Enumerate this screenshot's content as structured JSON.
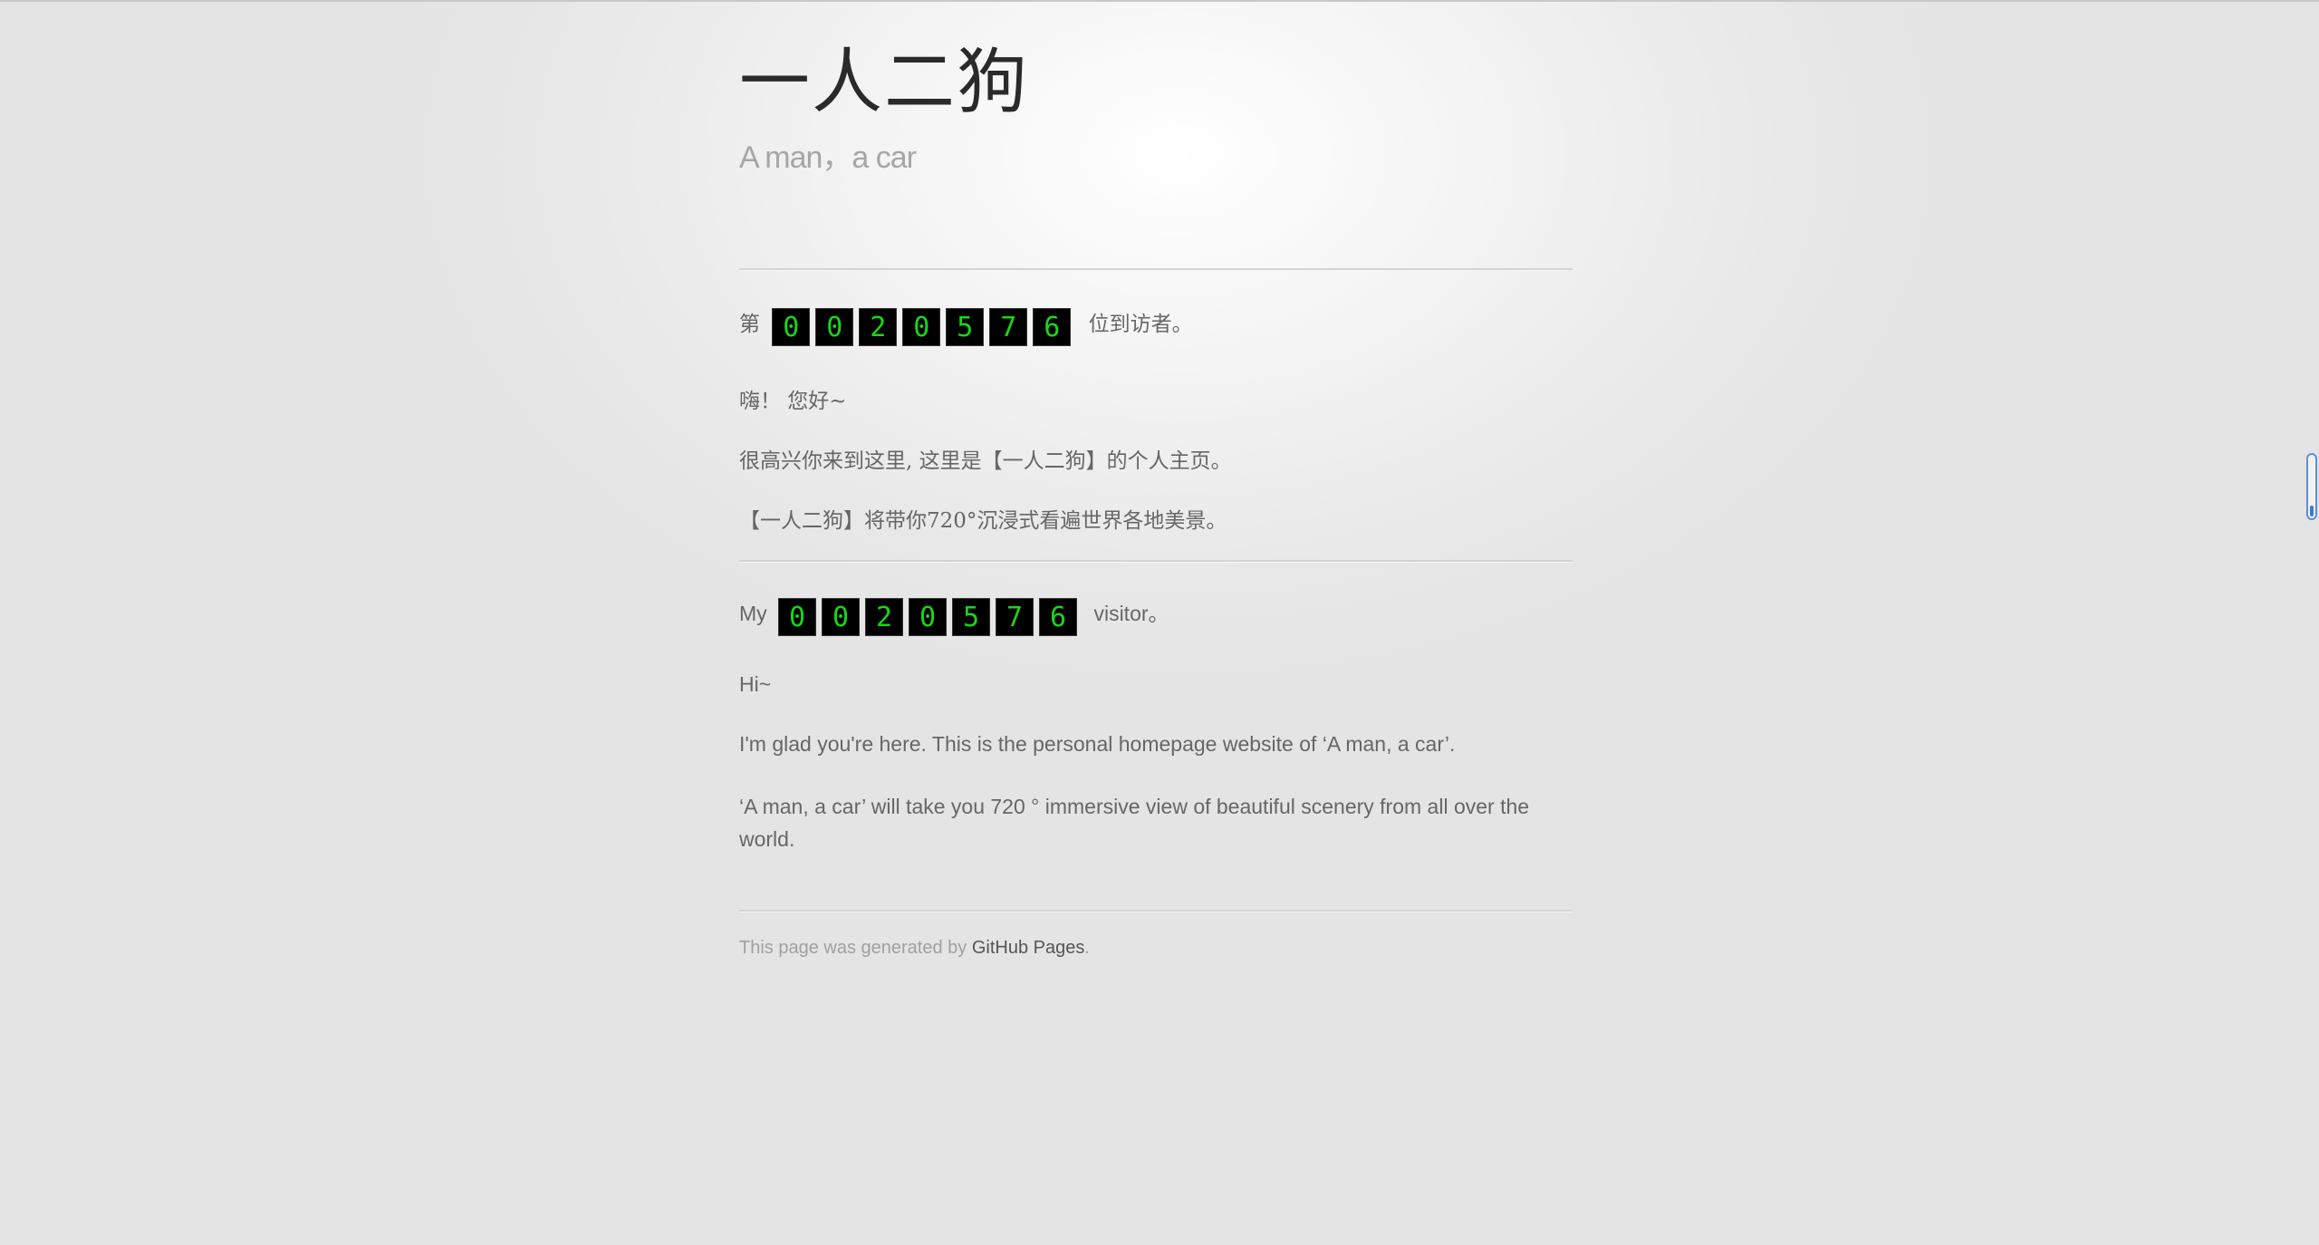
{
  "header": {
    "title": "一人二狗",
    "tagline": "A man，a car"
  },
  "counter": {
    "digits": [
      "0",
      "0",
      "2",
      "0",
      "5",
      "7",
      "6"
    ]
  },
  "zh": {
    "visitor_prefix": "第",
    "visitor_suffix": "位到访者。",
    "greeting": "嗨！ 您好~",
    "intro": "很高兴你来到这里, 这里是【一人二狗】的个人主页。",
    "desc": "【一人二狗】将带你720°沉浸式看遍世界各地美景。"
  },
  "en": {
    "visitor_prefix": "My",
    "visitor_suffix": "visitor。",
    "greeting": "Hi~",
    "intro": "I'm glad you're here. This is the personal homepage website of ‘A man, a car’.",
    "desc": "‘A man, a car’ will take you 720 ° immersive view of beautiful scenery from all over the world."
  },
  "footer": {
    "prefix": "This page was generated by",
    "link": "GitHub Pages",
    "suffix": "."
  }
}
